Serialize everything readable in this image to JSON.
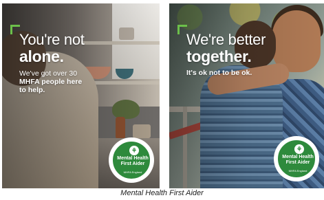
{
  "panels": [
    {
      "headline_light": "You're not",
      "headline_bold": "alone.",
      "sub_line1": "We've got over 30",
      "sub_bold": "MHFA people here",
      "sub_line2": "to help.",
      "badge_title": "Mental Health First Aider",
      "badge_subtitle": "MHFA England"
    },
    {
      "headline_light": "We're better",
      "headline_bold": "together.",
      "sub_bold": "It's ok not to be ok.",
      "badge_title": "Mental Health First Aider",
      "badge_subtitle": "MHFA England"
    }
  ],
  "caption": "Mental Health First Aider",
  "colors": {
    "accent_green": "#6cc04a",
    "badge_green": "#2e8a3c",
    "text_white": "#ffffff"
  },
  "icons": {
    "bracket": "corner-bracket-icon",
    "badge_mark": "mhfa-logo-icon"
  }
}
